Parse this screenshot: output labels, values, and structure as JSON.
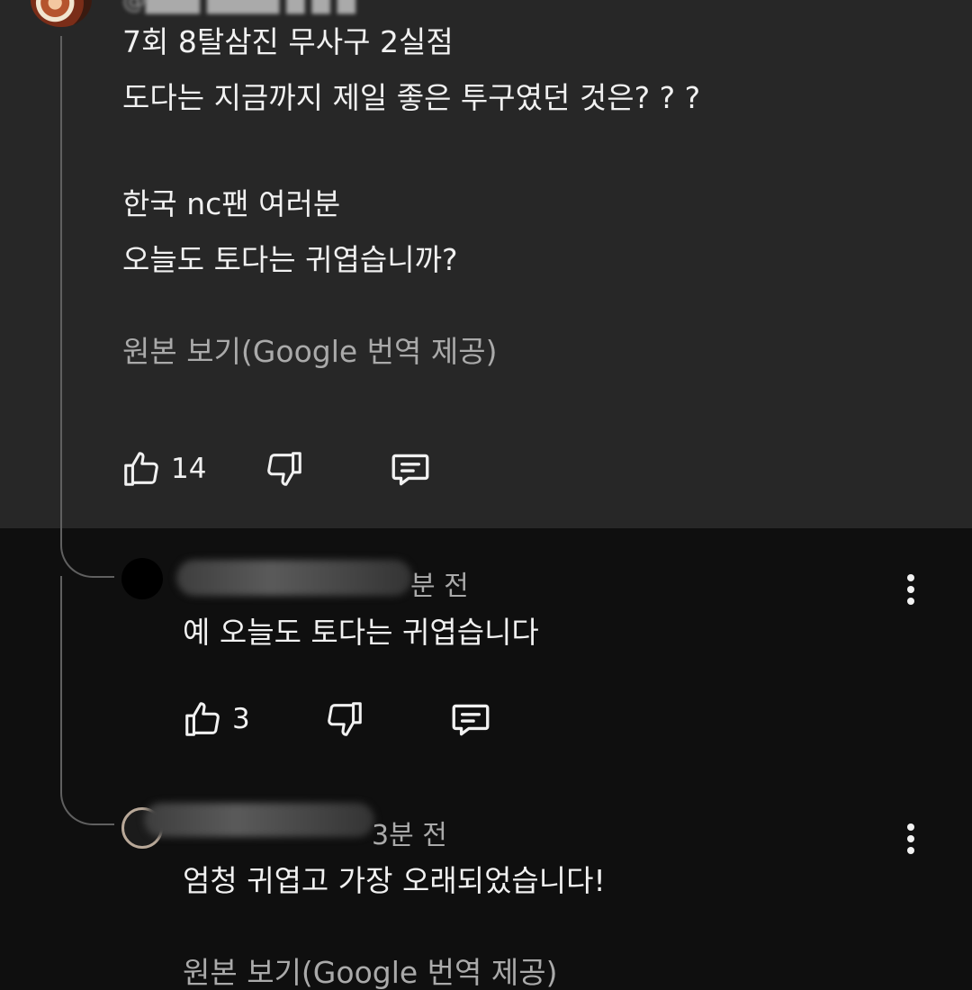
{
  "parent_comment": {
    "lines": [
      "7회 8탈삼진 무사구 2실점",
      "도다는 지금까지 제일 좋은 투구였던 것은? ? ?",
      "",
      "한국 nc팬 여러분",
      "오늘도 토다는 귀엽습니까?"
    ],
    "translation_toggle": "원본 보기(Google 번역 제공)",
    "like_count": "14"
  },
  "replies": [
    {
      "time": "분 전",
      "text": "예 오늘도 토다는 귀엽습니다",
      "like_count": "3"
    },
    {
      "time": "3분 전",
      "text": "엄청 귀엽고 가장 오래되었습니다!",
      "translation_toggle": "원본 보기(Google 번역 제공)"
    }
  ],
  "icons": {
    "like": "thumbs-up-icon",
    "dislike": "thumbs-down-icon",
    "reply": "reply-comment-icon",
    "more": "more-vertical-icon"
  },
  "colors": {
    "highlight_bg": "#272727",
    "page_bg": "#0f0f0f",
    "secondary_text": "#aaaaaa"
  }
}
